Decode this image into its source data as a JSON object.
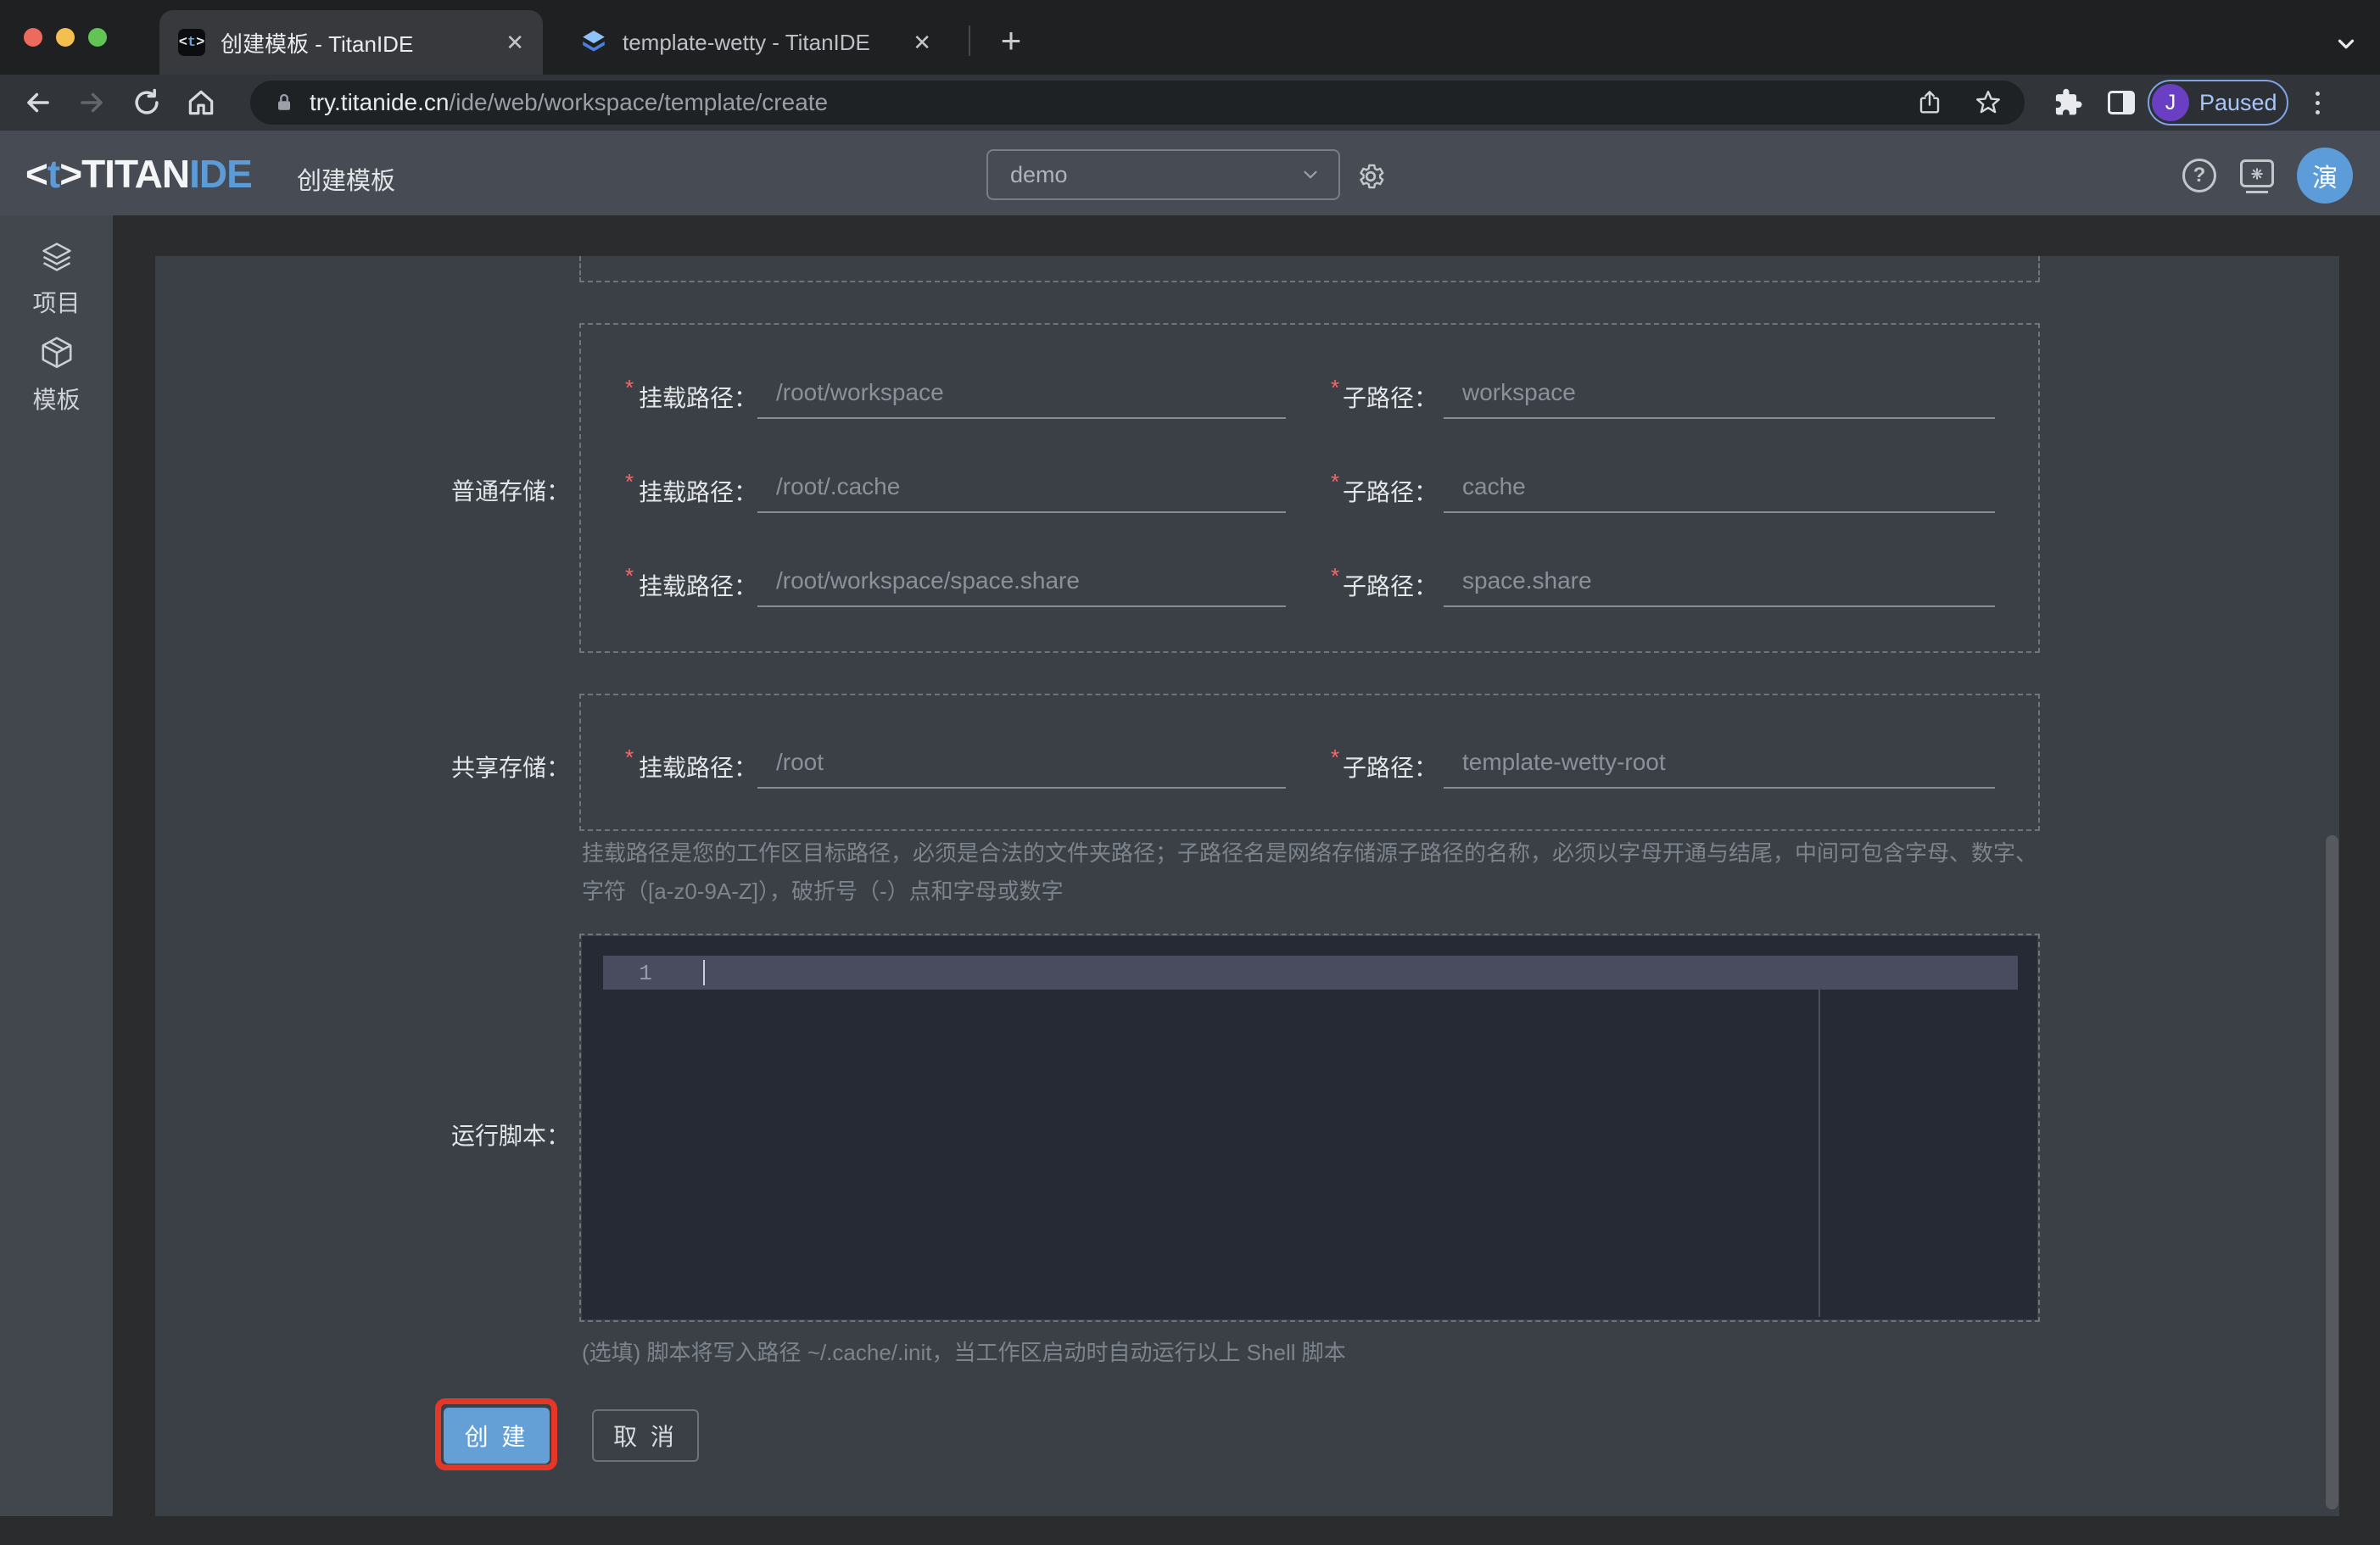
{
  "browser": {
    "tabs": [
      {
        "title": "创建模板 - TitanIDE",
        "close_glyph": "✕"
      },
      {
        "title": "template-wetty - TitanIDE",
        "close_glyph": "✕"
      }
    ],
    "new_tab_glyph": "+",
    "url": {
      "host": "try.titanide.cn",
      "path": "/ide/web/workspace/template/create"
    },
    "profile": {
      "avatar_initial": "J",
      "label": "Paused"
    }
  },
  "app_header": {
    "logo": {
      "bracket_open": "<",
      "t": "t",
      "bracket_close": ">",
      "titan": "TITAN",
      "ide": "IDE"
    },
    "page_title": "创建模板",
    "workspace_select": {
      "value": "demo"
    },
    "help_glyph": "?",
    "user_avatar": "演"
  },
  "sidebar": {
    "items": [
      {
        "label": "项目",
        "icon": "layers"
      },
      {
        "label": "模板",
        "icon": "cube"
      }
    ]
  },
  "form": {
    "required_mark": "*",
    "normal_storage_label": "普通存储：",
    "shared_storage_label": "共享存储：",
    "mount_label": "挂载路径：",
    "sub_label": "子路径：",
    "rows": [
      {
        "mount": "/root/workspace",
        "sub": "workspace"
      },
      {
        "mount": "/root/.cache",
        "sub": "cache"
      },
      {
        "mount": "/root/workspace/space.share",
        "sub": "space.share"
      },
      {
        "mount": "/root",
        "sub": "template-wetty-root"
      }
    ],
    "path_help": "挂载路径是您的工作区目标路径，必须是合法的文件夹路径；子路径名是网络存储源子路径的名称，必须以字母开通与结尾，中间可包含字母、数字、字符（[a-z0-9A-Z]），破折号（-）点和字母或数字",
    "script_label": "运行脚本：",
    "script_line_number": "1",
    "script_hint": "(选填) 脚本将写入路径 ~/.cache/.init，当工作区启动时自动运行以上 Shell 脚本",
    "create_button": "创 建",
    "cancel_button": "取 消"
  },
  "colors": {
    "accent_blue": "#64a0d6",
    "annotation_red": "#e53727",
    "required_red": "#f16a6a",
    "avatar_blue": "#5b9cd9",
    "profile_purple": "#6a3fc3",
    "paused_blue": "#a9c6f6"
  }
}
